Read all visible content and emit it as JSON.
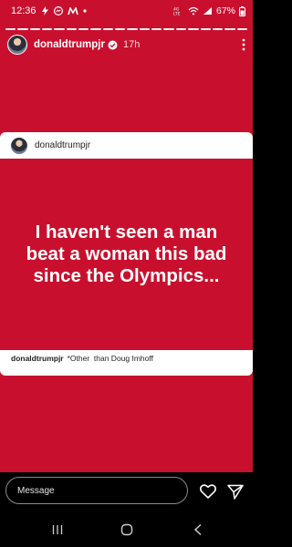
{
  "status_bar": {
    "time": "12:36",
    "battery": "67%",
    "signal_label": "4G LTE"
  },
  "story": {
    "username": "donaldtrumpjr",
    "time_ago": "17h",
    "progress_segments": 20
  },
  "post": {
    "username": "donaldtrumpjr",
    "quote_lines": [
      "I haven't seen a man",
      "beat a woman this bad",
      "since the Olympics..."
    ],
    "caption_user": "donaldtrumpjr",
    "caption_text": "*Other  than Doug Imhoff"
  },
  "reply": {
    "placeholder": "Message"
  },
  "colors": {
    "story_background": "#c8102e",
    "text": "#ffffff"
  }
}
